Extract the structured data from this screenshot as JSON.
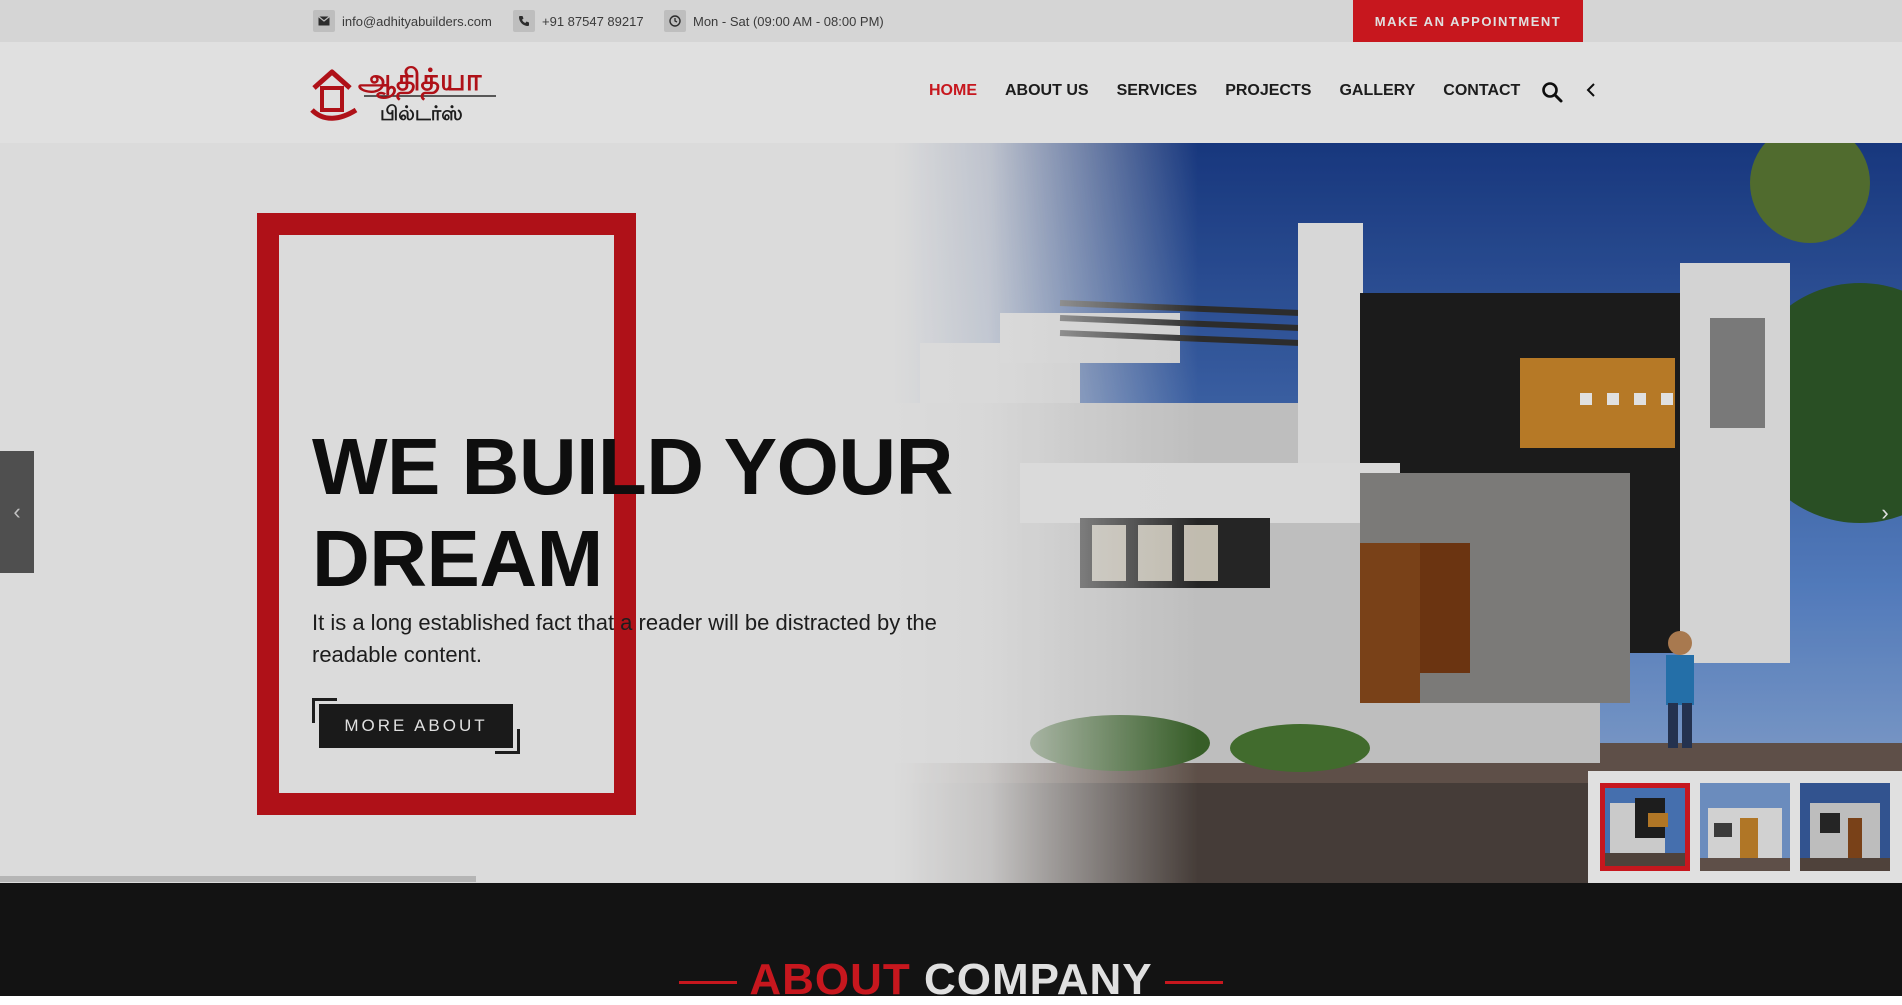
{
  "topbar": {
    "email": "info@adhityabuilders.com",
    "phone": "+91 87547 89217",
    "hours": "Mon - Sat (09:00 AM - 08:00 PM)",
    "appointment_label": "MAKE AN APPOINTMENT",
    "icons": [
      "envelope-icon",
      "phone-icon",
      "clock-icon"
    ]
  },
  "logo": {
    "line1": "ஆதித்யா",
    "line2": "பில்டர்ஸ்"
  },
  "nav": {
    "items": [
      {
        "label": "HOME",
        "active": true
      },
      {
        "label": "ABOUT US",
        "active": false
      },
      {
        "label": "SERVICES",
        "active": false
      },
      {
        "label": "PROJECTS",
        "active": false
      },
      {
        "label": "GALLERY",
        "active": false
      },
      {
        "label": "CONTACT",
        "active": false
      }
    ]
  },
  "hero": {
    "headline_line1": "WE BUILD YOUR",
    "headline_line2": "DREAM",
    "subtext_line1": "It is a long established fact that a reader will be distracted by the",
    "subtext_line2": "readable content.",
    "button_label": "MORE ABOUT",
    "prev_arrow": "‹",
    "next_arrow": "›",
    "slider_progress": 0.25,
    "thumbnails": [
      {
        "name": "slide-thumb-1",
        "selected": true
      },
      {
        "name": "slide-thumb-2",
        "selected": false
      },
      {
        "name": "slide-thumb-3",
        "selected": false
      }
    ]
  },
  "about": {
    "heading_red": "ABOUT",
    "heading_white": "COMPANY"
  },
  "colors": {
    "accent": "#e31b23",
    "frame": "#c8141c",
    "dark_section": "#161616"
  }
}
